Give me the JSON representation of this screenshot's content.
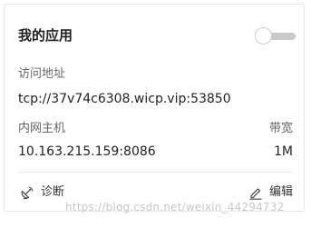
{
  "card": {
    "title": "我的应用",
    "toggle_state": "off"
  },
  "address": {
    "label": "访问地址",
    "value": "tcp://37v74c6308.wicp.vip:53850"
  },
  "lan_host": {
    "label": "内网主机",
    "value": "10.163.215.159:8086"
  },
  "bandwidth": {
    "label": "带宽",
    "value": "1M"
  },
  "actions": {
    "diagnose_label": "诊断",
    "diagnose_icon": "satellite-dish-icon",
    "edit_label": "编辑",
    "edit_icon": "pencil-icon"
  },
  "watermark": "https://blog.csdn.net/weixin_44294732",
  "colors": {
    "toggle_track": "#c9c9c9",
    "border": "#e6e6e6",
    "text_primary": "#222222",
    "text_secondary": "#666666"
  }
}
